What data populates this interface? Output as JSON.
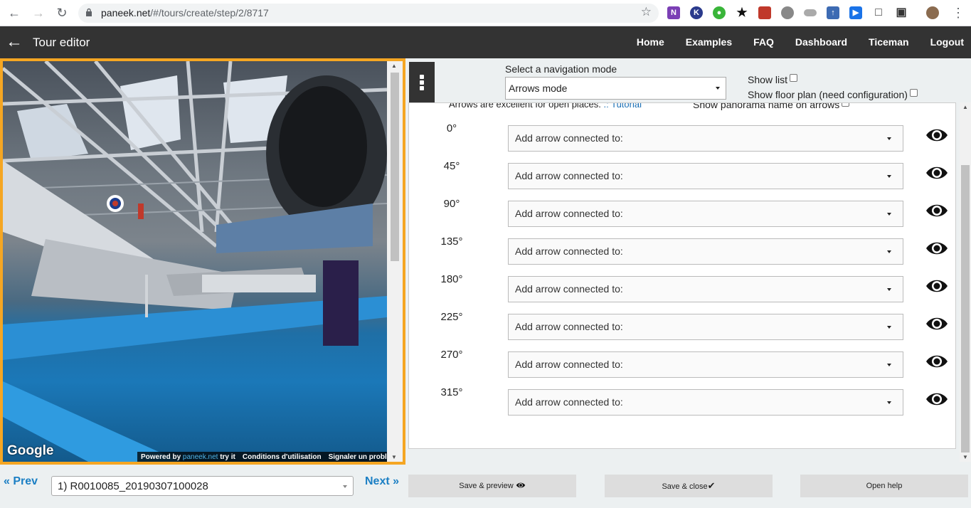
{
  "browser": {
    "url_host": "paneek.net",
    "url_path": "/#/tours/create/step/2/8717"
  },
  "header": {
    "title": "Tour editor",
    "nav": [
      "Home",
      "Examples",
      "FAQ",
      "Dashboard",
      "Ticeman",
      "Logout"
    ]
  },
  "viewer": {
    "google_label": "Google",
    "footer": {
      "powered_by": "Powered by",
      "brand": "paneek.net",
      "try_it": "try it",
      "terms": "Conditions d'utilisation",
      "report": "Signaler un problème"
    }
  },
  "settings": {
    "mode_label": "Select a navigation mode",
    "mode_value": "Arrows mode",
    "show_list": "Show list",
    "show_floor_plan": "Show floor plan (need configuration)",
    "hint": "Arrows are excellent for open places.",
    "hint_link": ".: Tutorial",
    "show_names": "Show panorama name on arrows"
  },
  "arrows": [
    {
      "angle": "0°",
      "value": "Add arrow connected to:"
    },
    {
      "angle": "45°",
      "value": "Add arrow connected to:"
    },
    {
      "angle": "90°",
      "value": "Add arrow connected to:"
    },
    {
      "angle": "135°",
      "value": "Add arrow connected to:"
    },
    {
      "angle": "180°",
      "value": "Add arrow connected to:"
    },
    {
      "angle": "225°",
      "value": "Add arrow connected to:"
    },
    {
      "angle": "270°",
      "value": "Add arrow connected to:"
    },
    {
      "angle": "315°",
      "value": "Add arrow connected to:"
    }
  ],
  "bottom": {
    "prev": "Prev",
    "next": "Next",
    "panorama": "1) R0010085_20190307100028",
    "save_preview": "Save & preview",
    "save_close": "Save & close",
    "open_help": "Open help"
  },
  "colors": {
    "accent_border": "#f5a623",
    "link": "#1b7fc4",
    "header_bg": "#333333"
  }
}
